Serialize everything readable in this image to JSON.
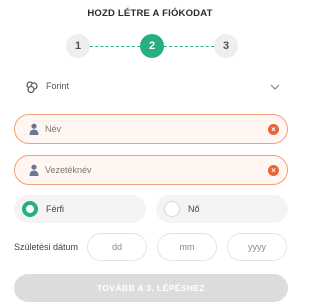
{
  "header": {
    "title": "HOZD LÉTRE A FIÓKODAT"
  },
  "stepper": {
    "steps": [
      "1",
      "2",
      "3"
    ],
    "active_step": 2,
    "accent_color": "#27ae83"
  },
  "currency": {
    "selected": "Forint",
    "icon": "coins-icon"
  },
  "form": {
    "first_name": {
      "placeholder": "Név",
      "value": ""
    },
    "last_name": {
      "placeholder": "Vezetéknév",
      "value": ""
    },
    "error_color": "#e8633a"
  },
  "gender": {
    "options": [
      "Férfi",
      "Nő"
    ],
    "selected": "Férfi"
  },
  "dob": {
    "label": "Születési dátum",
    "day_placeholder": "dd",
    "month_placeholder": "mm",
    "year_placeholder": "yyyy"
  },
  "next_button": {
    "label": "TOVÁBB A 3. LÉPÉSHEZ",
    "enabled": false
  }
}
